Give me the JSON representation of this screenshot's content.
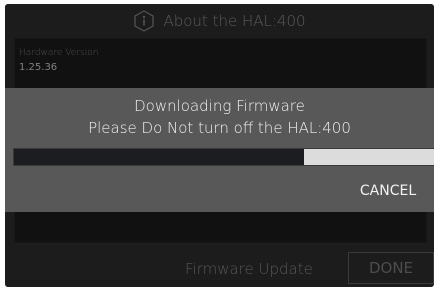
{
  "header": {
    "title": "About the HAL:400",
    "icon": "info-icon"
  },
  "info": {
    "hardware_version_label": "Hardware Version",
    "hardware_version_value": "1.25.36"
  },
  "footer": {
    "firmware_update_label": "Firmware Update",
    "done_label": "DONE"
  },
  "dialog": {
    "title": "Downloading Firmware",
    "message": "Please Do Not turn off the HAL:400",
    "progress": 0.69,
    "cancel_label": "CANCEL"
  }
}
